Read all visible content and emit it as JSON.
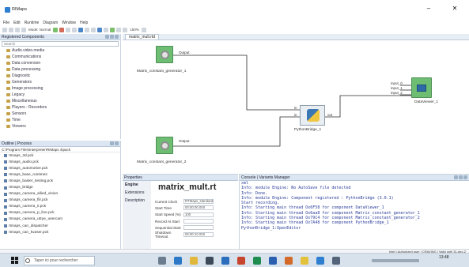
{
  "window": {
    "title": "RIMaps",
    "minimize": "–",
    "close": "✕"
  },
  "menu": [
    "File",
    "Edit",
    "Runtime",
    "Diagram",
    "Window",
    "Help"
  ],
  "toolbar": {
    "mode_label": "Mode: Normal",
    "zoom_value": "150%"
  },
  "components_panel": {
    "title": "Registered Components",
    "search_placeholder": "Search",
    "items": [
      "Audio.video.media",
      "Communications",
      "Data conversion",
      "Data processing",
      "Diagnostic",
      "Generators",
      "Image processing",
      "Legacy",
      "Miscellaneous",
      "Players - Recorders",
      "Sensors",
      "Time",
      "Viewers"
    ]
  },
  "outline_panel": {
    "tabs": [
      "Outline",
      "Process"
    ],
    "path": "C:\\Program Files\\Interpreter\\RIMaps 4\\pack",
    "files": [
      "rtmaps_3d.pck",
      "rtmaps_audio.pck",
      "rtmaps_automotive.pck",
      "rtmaps_base_runtimes",
      "rtmaps_basler_testing.pck",
      "rtmaps_bridge",
      "rtmaps_camera_allied_vision",
      "rtmaps_camera_flir.pck",
      "rtmaps_camera_ti.pck",
      "rtmaps_camera_p_line.pck",
      "rtmaps_camera_uEye_usercam",
      "rtmaps_can_dispatcher",
      "rtmaps_can_kvaser.pck"
    ]
  },
  "diagram": {
    "tab_label": "matrix_mult.rtd",
    "components": [
      {
        "name": "Matrix_constant_generator_1",
        "port": "Output"
      },
      {
        "name": "Matrix_constant_generator_2",
        "port": "Output"
      },
      {
        "name": "PythonBridge_1",
        "in_ports": [
          "in",
          "in"
        ],
        "out_port": "out"
      },
      {
        "name": "DataViewer_1",
        "in_ports": [
          "input_0",
          "input_1",
          "input_2"
        ]
      }
    ]
  },
  "properties": {
    "tab_label": "Properties",
    "side_items": [
      "Engine",
      "Extensions",
      "Description"
    ],
    "title": "matrix_mult.rt",
    "rows": [
      {
        "key": "Current Clock",
        "value": "RTMaps_standard"
      },
      {
        "key": "Start Time",
        "value": "00:00:00.000"
      },
      {
        "key": "Start Speed (%)",
        "value": "100"
      },
      {
        "key": "Record At Start",
        "value": ""
      },
      {
        "key": "Sequential Start",
        "value": ""
      },
      {
        "key": "Shutdown Timeout",
        "value": "00:00:10.000"
      }
    ]
  },
  "console": {
    "tabs": [
      "Console",
      "Variants Manager"
    ],
    "lines": [
      "xml",
      "Info: module Engine: No AutoSave file detected",
      "Info: Done.",
      "Info: module Engine: Component registered : PythonBridge (3.0.1)",
      "Start recording.",
      "Info: Starting main thread Ox6F58 for component DataViewer_1",
      "Info: Starting main thread Ox6aa8 for component Matrix_constant_generator_1",
      "Info: Starting main thread Ox79C4 for component Matrix_constant_generator_2",
      "Info: Starting main thread Ox7A48 for component PythonBridge_1",
      "PythonBridge_1:OpenEditor"
    ]
  },
  "statusbar": {
    "text": "Intel | Authorized user | CRAVING | Valid until 31-dec-2"
  },
  "taskbar": {
    "search_placeholder": "Taper ici pour rechercher",
    "time": "13:48"
  },
  "colors": {
    "component_green": "#6dbd73",
    "console_text": "#2b3d9a",
    "panel_header": "#dbe6f2"
  }
}
